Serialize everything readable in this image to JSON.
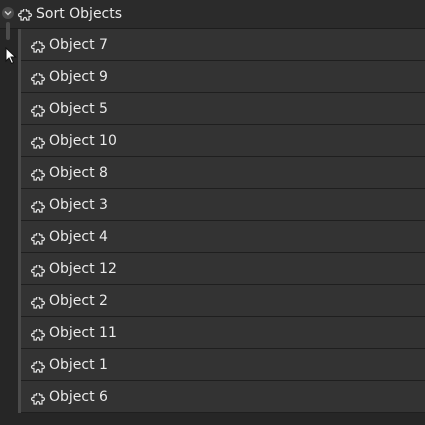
{
  "tree": {
    "root": {
      "label": "Sort Objects",
      "icon": "puzzle-piece-icon",
      "expanded": true
    },
    "children": [
      {
        "label": "Object 7",
        "icon": "puzzle-piece-icon"
      },
      {
        "label": "Object 9",
        "icon": "puzzle-piece-icon"
      },
      {
        "label": "Object 5",
        "icon": "puzzle-piece-icon"
      },
      {
        "label": "Object 10",
        "icon": "puzzle-piece-icon"
      },
      {
        "label": "Object 8",
        "icon": "puzzle-piece-icon"
      },
      {
        "label": "Object 3",
        "icon": "puzzle-piece-icon"
      },
      {
        "label": "Object 4",
        "icon": "puzzle-piece-icon"
      },
      {
        "label": "Object 12",
        "icon": "puzzle-piece-icon"
      },
      {
        "label": "Object 2",
        "icon": "puzzle-piece-icon"
      },
      {
        "label": "Object 11",
        "icon": "puzzle-piece-icon"
      },
      {
        "label": "Object 1",
        "icon": "puzzle-piece-icon"
      },
      {
        "label": "Object 6",
        "icon": "puzzle-piece-icon"
      }
    ]
  },
  "colors": {
    "background": "#262626",
    "row": "#333333",
    "text": "#eaeaea",
    "guide": "#4a4a4a"
  }
}
